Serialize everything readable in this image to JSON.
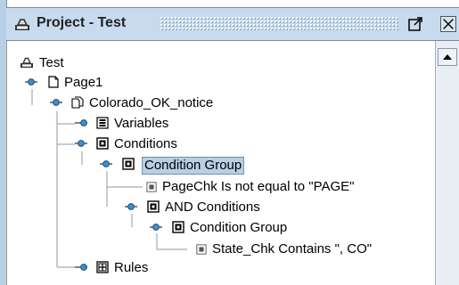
{
  "window": {
    "title": "Project - Test"
  },
  "tree": {
    "nodes": [
      {
        "label": "Test",
        "icon": "project-icon"
      },
      {
        "label": "Page1",
        "icon": "page-icon"
      },
      {
        "label": "Colorado_OK_notice",
        "icon": "document-copy-icon"
      },
      {
        "label": "Variables",
        "icon": "variables-icon"
      },
      {
        "label": "Conditions",
        "icon": "conditions-icon"
      },
      {
        "label": "Condition Group",
        "icon": "condition-group-icon",
        "selected": true
      },
      {
        "label": "PageChk Is not equal to \"PAGE\"",
        "icon": "condition-icon"
      },
      {
        "label": "AND Conditions",
        "icon": "conditions-icon"
      },
      {
        "label": "Condition Group",
        "icon": "condition-group-icon"
      },
      {
        "label": "State_Chk Contains \", CO\"",
        "icon": "condition-icon"
      },
      {
        "label": "Rules",
        "icon": "rules-icon"
      }
    ]
  },
  "colors": {
    "titlebar": "#c8dbee",
    "selection": "#b8cfe5"
  }
}
